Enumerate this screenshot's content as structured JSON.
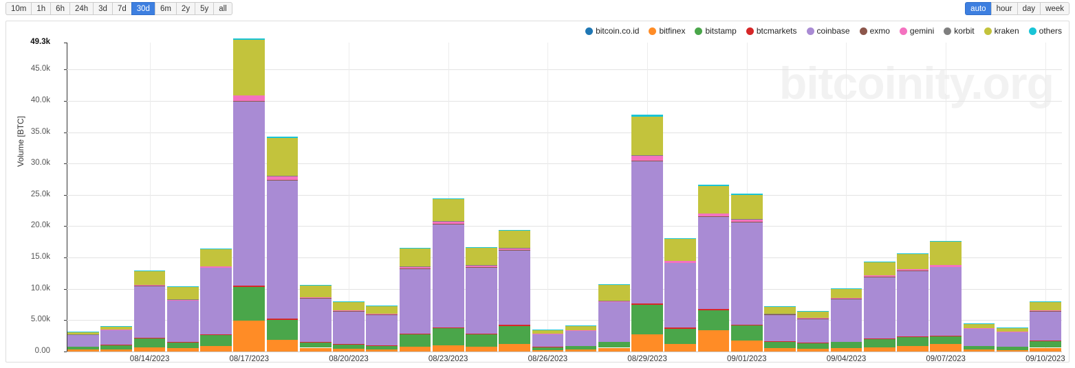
{
  "range_toolbar": {
    "name": "time-range-selector",
    "options": [
      "10m",
      "1h",
      "6h",
      "24h",
      "3d",
      "7d",
      "30d",
      "6m",
      "2y",
      "5y",
      "all"
    ],
    "selected": "30d"
  },
  "resolution_toolbar": {
    "name": "resolution-selector",
    "options": [
      "auto",
      "hour",
      "day",
      "week"
    ],
    "selected": "auto"
  },
  "watermark": "bitcoinity.org",
  "chart_data": {
    "type": "bar",
    "stacked": true,
    "title": "",
    "subtitle": "",
    "xlabel": "",
    "ylabel": "Volume [BTC]",
    "ylim": [
      0,
      49300
    ],
    "grid": true,
    "legend_position": "top-right",
    "ytick_labels": [
      "0.00",
      "5.00k",
      "10.0k",
      "15.0k",
      "20.0k",
      "25.0k",
      "30.0k",
      "35.0k",
      "40.0k",
      "45.0k",
      "49.3k"
    ],
    "ytick_values": [
      0,
      5000,
      10000,
      15000,
      20000,
      25000,
      30000,
      35000,
      40000,
      45000,
      49300
    ],
    "xtick_labels": [
      "08/14/2023",
      "08/17/2023",
      "08/20/2023",
      "08/23/2023",
      "08/26/2023",
      "08/29/2023",
      "09/01/2023",
      "09/04/2023",
      "09/07/2023",
      "09/10/2023"
    ],
    "xtick_indices": [
      2,
      5,
      8,
      11,
      14,
      17,
      20,
      23,
      26,
      29
    ],
    "categories": [
      "08/12/2023",
      "08/13/2023",
      "08/14/2023",
      "08/15/2023",
      "08/16/2023",
      "08/17/2023",
      "08/18/2023",
      "08/19/2023",
      "08/20/2023",
      "08/21/2023",
      "08/22/2023",
      "08/23/2023",
      "08/24/2023",
      "08/25/2023",
      "08/26/2023",
      "08/27/2023",
      "08/28/2023",
      "08/29/2023",
      "08/30/2023",
      "08/31/2023",
      "09/01/2023",
      "09/02/2023",
      "09/03/2023",
      "09/04/2023",
      "09/05/2023",
      "09/06/2023",
      "09/07/2023",
      "09/08/2023",
      "09/09/2023",
      "09/10/2023"
    ],
    "series": [
      {
        "name": "bitcoin.co.id",
        "color": "#1f77b4",
        "values": [
          5,
          5,
          5,
          5,
          5,
          10,
          10,
          5,
          5,
          5,
          5,
          5,
          5,
          5,
          5,
          5,
          5,
          10,
          5,
          5,
          5,
          5,
          5,
          5,
          5,
          5,
          5,
          5,
          5,
          5
        ]
      },
      {
        "name": "bitfinex",
        "color": "#ff8c26",
        "values": [
          300,
          350,
          700,
          500,
          900,
          4900,
          1900,
          600,
          400,
          350,
          800,
          950,
          800,
          1150,
          250,
          300,
          600,
          2700,
          1150,
          3400,
          1750,
          550,
          450,
          500,
          700,
          900,
          1200,
          350,
          250,
          600
        ]
      },
      {
        "name": "bitstamp",
        "color": "#4aa64a",
        "values": [
          450,
          700,
          1400,
          900,
          1700,
          5400,
          3100,
          800,
          750,
          550,
          1900,
          2750,
          1900,
          2900,
          450,
          550,
          900,
          4700,
          2500,
          3150,
          2400,
          1000,
          900,
          1000,
          1300,
          1450,
          1250,
          500,
          500,
          1100
        ]
      },
      {
        "name": "btcmarkets",
        "color": "#d62728",
        "values": [
          60,
          70,
          120,
          90,
          130,
          250,
          200,
          80,
          70,
          60,
          120,
          180,
          130,
          170,
          50,
          60,
          80,
          220,
          150,
          190,
          150,
          80,
          70,
          80,
          90,
          100,
          100,
          50,
          50,
          80
        ]
      },
      {
        "name": "coinbase",
        "color": "#a98bd4",
        "values": [
          1800,
          2300,
          8200,
          6600,
          10600,
          29300,
          22100,
          7000,
          5200,
          4900,
          10400,
          16400,
          10600,
          11900,
          2000,
          2400,
          6300,
          22700,
          10300,
          14800,
          16300,
          4200,
          3800,
          6800,
          9800,
          10400,
          10900,
          2700,
          2300,
          4600
        ]
      },
      {
        "name": "exmo",
        "color": "#8c564b",
        "values": [
          20,
          20,
          40,
          30,
          50,
          90,
          70,
          30,
          25,
          25,
          40,
          60,
          45,
          55,
          20,
          20,
          30,
          80,
          50,
          60,
          50,
          30,
          25,
          30,
          35,
          35,
          40,
          20,
          20,
          30
        ]
      },
      {
        "name": "gemini",
        "color": "#f472c0",
        "values": [
          60,
          70,
          180,
          150,
          220,
          900,
          600,
          160,
          120,
          110,
          280,
          420,
          260,
          300,
          60,
          70,
          150,
          850,
          300,
          400,
          420,
          120,
          100,
          170,
          240,
          260,
          280,
          70,
          60,
          130
        ]
      },
      {
        "name": "korbit",
        "color": "#7f7f7f",
        "values": [
          10,
          10,
          15,
          12,
          18,
          40,
          30,
          14,
          12,
          10,
          20,
          25,
          18,
          22,
          10,
          10,
          14,
          35,
          20,
          25,
          22,
          12,
          10,
          14,
          18,
          18,
          20,
          10,
          10,
          14
        ]
      },
      {
        "name": "kraken",
        "color": "#c3c33c",
        "values": [
          350,
          450,
          2200,
          2050,
          2700,
          8800,
          6100,
          1800,
          1350,
          1250,
          2900,
          3500,
          2800,
          2800,
          550,
          650,
          2600,
          6200,
          3500,
          4400,
          3900,
          1200,
          1000,
          1350,
          2100,
          2450,
          3700,
          700,
          600,
          1300
        ]
      },
      {
        "name": "others",
        "color": "#19c4d6",
        "values": [
          40,
          50,
          90,
          80,
          110,
          320,
          220,
          70,
          50,
          50,
          110,
          140,
          110,
          120,
          30,
          35,
          70,
          250,
          130,
          170,
          150,
          50,
          45,
          60,
          90,
          100,
          110,
          35,
          30,
          60
        ]
      }
    ]
  }
}
